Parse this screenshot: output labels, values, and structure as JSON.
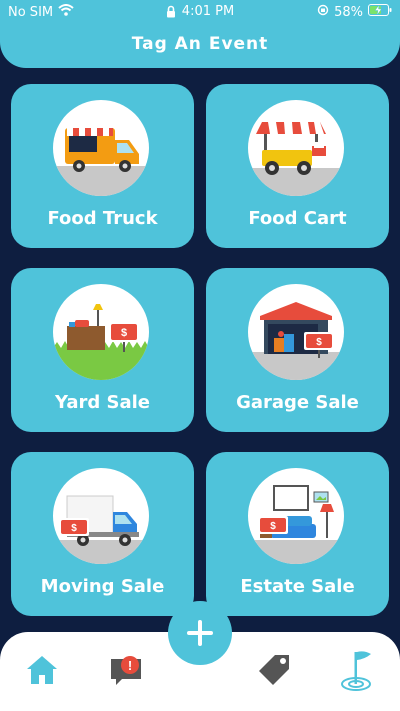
{
  "status_bar": {
    "carrier": "No SIM",
    "time": "4:01 PM",
    "battery": "58%"
  },
  "header": {
    "title": "Tag An Event"
  },
  "events": [
    {
      "label": "Food Truck",
      "icon": "food-truck-icon"
    },
    {
      "label": "Food Cart",
      "icon": "food-cart-icon"
    },
    {
      "label": "Yard Sale",
      "icon": "yard-sale-icon"
    },
    {
      "label": "Garage Sale",
      "icon": "garage-sale-icon"
    },
    {
      "label": "Moving Sale",
      "icon": "moving-sale-icon"
    },
    {
      "label": "Estate Sale",
      "icon": "estate-sale-icon"
    }
  ],
  "price_tag_symbol": "$",
  "fab_icon": "plus-icon",
  "bottom_nav": [
    {
      "icon": "home-icon",
      "active": true
    },
    {
      "icon": "alert-message-icon",
      "badge": "!"
    },
    {
      "icon": "tag-icon"
    },
    {
      "icon": "flag-location-icon"
    }
  ],
  "colors": {
    "accent": "#4fc3da",
    "background": "#0e1e40",
    "price_tag": "#e74c3c"
  }
}
